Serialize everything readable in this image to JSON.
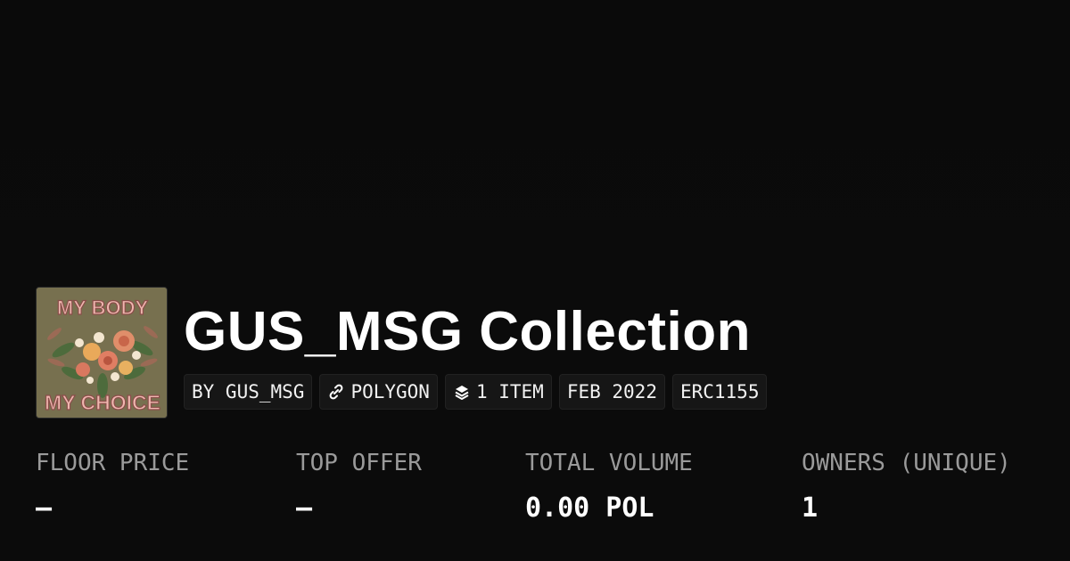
{
  "collection": {
    "title": "GUS_MSG Collection",
    "thumbnail": {
      "top_text": "MY BODY",
      "bottom_text": "MY CHOICE"
    }
  },
  "chips": [
    {
      "label": "BY GUS_MSG",
      "icon": ""
    },
    {
      "label": "POLYGON",
      "icon": "link-icon"
    },
    {
      "label": "1 ITEM",
      "icon": "layers-icon"
    },
    {
      "label": "FEB 2022",
      "icon": ""
    },
    {
      "label": "ERC1155",
      "icon": ""
    }
  ],
  "stats": [
    {
      "label": "FLOOR PRICE",
      "value": "–"
    },
    {
      "label": "TOP OFFER",
      "value": "–"
    },
    {
      "label": "TOTAL VOLUME",
      "value": "0.00 POL"
    },
    {
      "label": "OWNERS (UNIQUE)",
      "value": "1"
    }
  ],
  "colors": {
    "background": "#0b0b0b",
    "text": "#ffffff",
    "muted": "#9a9a9a",
    "chip_bg": "#161616"
  }
}
